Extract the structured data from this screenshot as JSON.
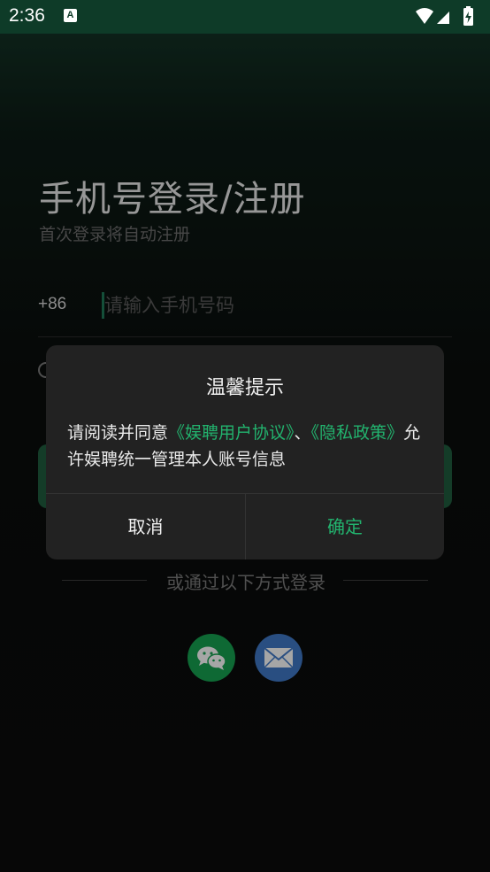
{
  "status_bar": {
    "time": "2:36",
    "notification_icon": "A",
    "icons": [
      "wifi-icon",
      "cell-signal-icon",
      "battery-charging-icon"
    ]
  },
  "login": {
    "title": "手机号登录/注册",
    "subtitle": "首次登录将自动注册",
    "country_code": "+86",
    "phone_placeholder": "请输入手机号码",
    "phone_value": "",
    "divider_text": "或通过以下方式登录",
    "social_icons": [
      "wechat-icon",
      "mail-icon"
    ]
  },
  "dialog": {
    "title": "温馨提示",
    "body_prefix": "请阅读并同意",
    "link_user_agreement": "《娱聘用户协议》",
    "separator": "、",
    "link_privacy_policy": "《隐私政策》",
    "body_suffix": "允许娱聘统一管理本人账号信息",
    "cancel_label": "取消",
    "confirm_label": "确定"
  },
  "colors": {
    "accent": "#22b36e",
    "status_bar": "#0e3b28",
    "dialog_bg": "#222222",
    "wechat": "#16a150",
    "mail": "#3f78c7"
  }
}
